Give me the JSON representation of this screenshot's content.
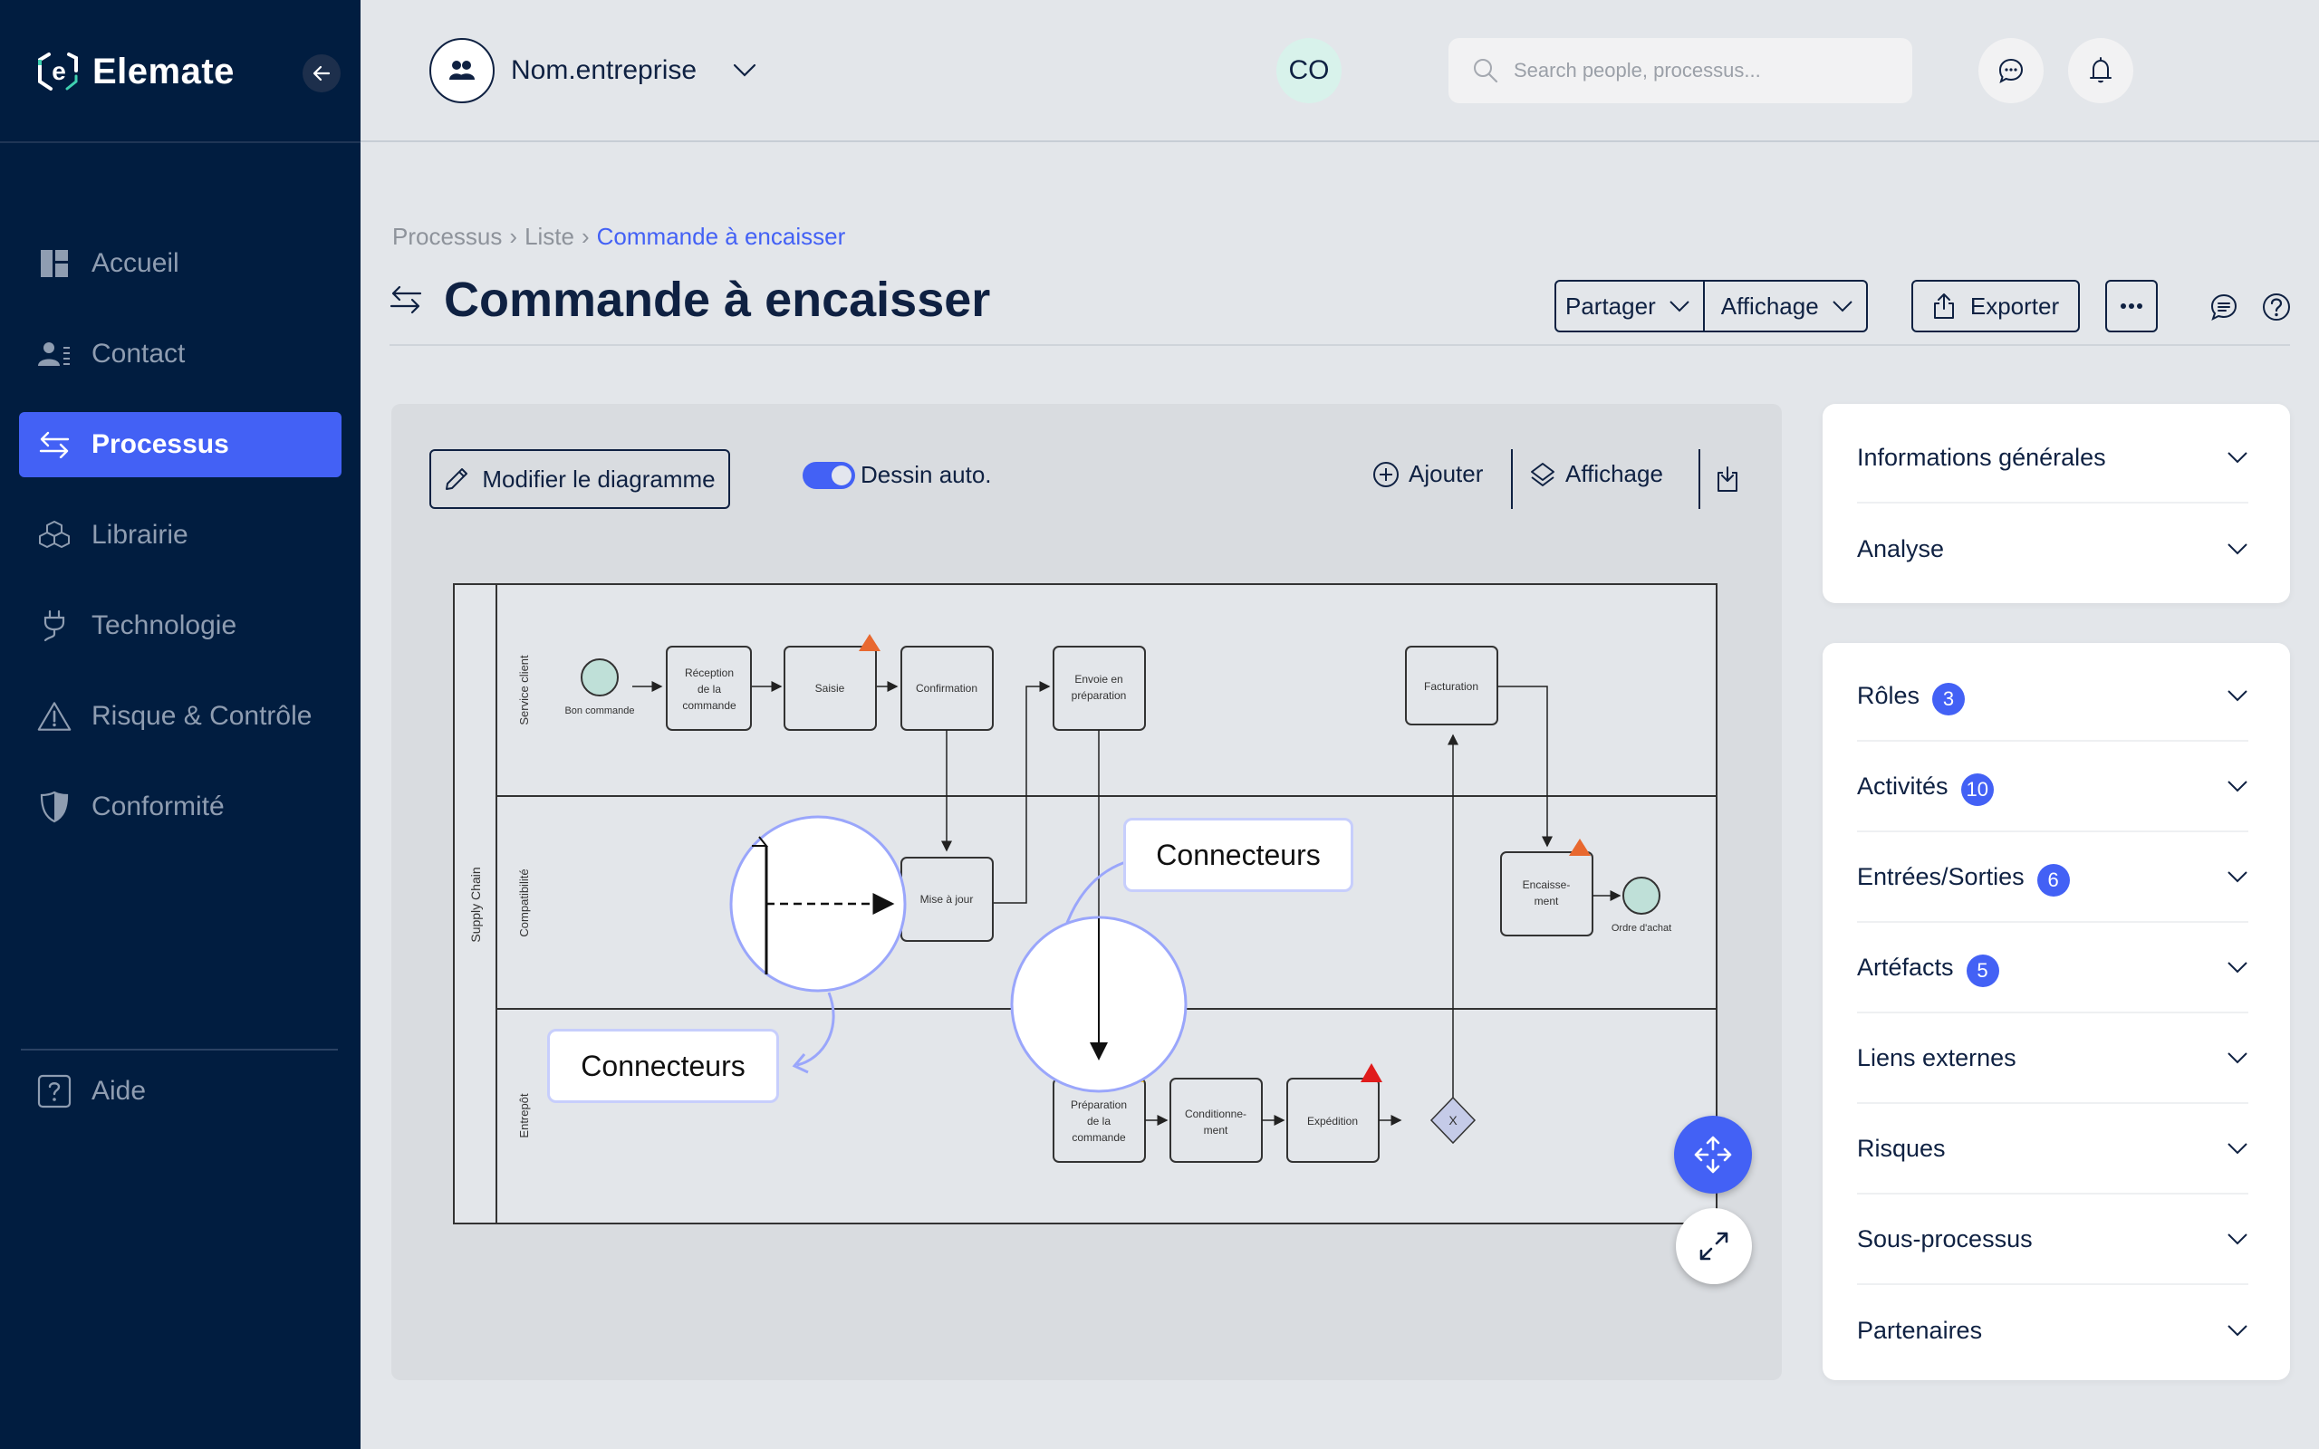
{
  "app": {
    "name": "Elemate"
  },
  "sidebar": {
    "items": [
      {
        "label": "Accueil",
        "icon": "dashboard-icon",
        "active": false
      },
      {
        "label": "Contact",
        "icon": "contact-list-icon",
        "active": false
      },
      {
        "label": "Processus",
        "icon": "swap-arrows-icon",
        "active": true
      },
      {
        "label": "Librairie",
        "icon": "cubes-icon",
        "active": false
      },
      {
        "label": "Technologie",
        "icon": "plug-icon",
        "active": false
      },
      {
        "label": "Risque & Contrôle",
        "icon": "warning-icon",
        "active": false
      },
      {
        "label": "Conformité",
        "icon": "shield-icon",
        "active": false
      }
    ],
    "help_label": "Aide"
  },
  "topbar": {
    "company_name": "Nom.entreprise",
    "search_placeholder": "Search people, processus...",
    "user_initials": "CO"
  },
  "breadcrumb": [
    "Processus",
    "Liste",
    "Commande à encaisser"
  ],
  "page": {
    "title": "Commande à encaisser",
    "actions": {
      "share": "Partager",
      "display": "Affichage",
      "export": "Exporter"
    }
  },
  "diagram_toolbar": {
    "edit": "Modifier le diagramme",
    "auto_draw": "Dessin auto.",
    "auto_draw_on": true,
    "add": "Ajouter",
    "display": "Affichage"
  },
  "diagram": {
    "pool": "Supply Chain",
    "lanes": [
      "Service client",
      "Compatibilité",
      "Entrepôt"
    ],
    "events": {
      "start": "Bon commande",
      "end": "Ordre d'achat"
    },
    "tasks": {
      "reception": [
        "Réception",
        "de la",
        "commande"
      ],
      "saisie": "Saisie",
      "confirmation": "Confirmation",
      "envoi": [
        "Envoie en",
        "préparation"
      ],
      "facturation": "Facturation",
      "mise_a_jour": "Mise à jour",
      "encaissement": [
        "Encaisse-",
        "ment"
      ],
      "preparation": [
        "Préparation",
        "de la",
        "commande"
      ],
      "conditionnement": [
        "Conditionne-",
        "ment"
      ],
      "expedition": "Expédition"
    },
    "gateway": "X",
    "callouts": [
      "Connecteurs",
      "Connecteurs"
    ],
    "colors": {
      "event_fill": "#bfe0d8",
      "warning_orange": "#e8682f",
      "warning_red": "#e01c1c",
      "warning_yellow": "#f0c419",
      "gateway_fill": "#c5cbe8",
      "callout_border": "#9aa6fb"
    }
  },
  "right_panel": {
    "top": [
      {
        "label": "Informations générales"
      },
      {
        "label": "Analyse"
      }
    ],
    "bottom": [
      {
        "label": "Rôles",
        "count": "3"
      },
      {
        "label": "Activités",
        "count": "10"
      },
      {
        "label": "Entrées/Sorties",
        "count": "6"
      },
      {
        "label": "Artéfacts",
        "count": "5"
      },
      {
        "label": "Liens externes"
      },
      {
        "label": "Risques"
      },
      {
        "label": "Sous-processus"
      },
      {
        "label": "Partenaires"
      }
    ]
  },
  "colors": {
    "sidebar_bg": "#011d40",
    "accent": "#4361f5",
    "text_dark": "#0f2142",
    "page_bg": "#e3e6ea"
  }
}
